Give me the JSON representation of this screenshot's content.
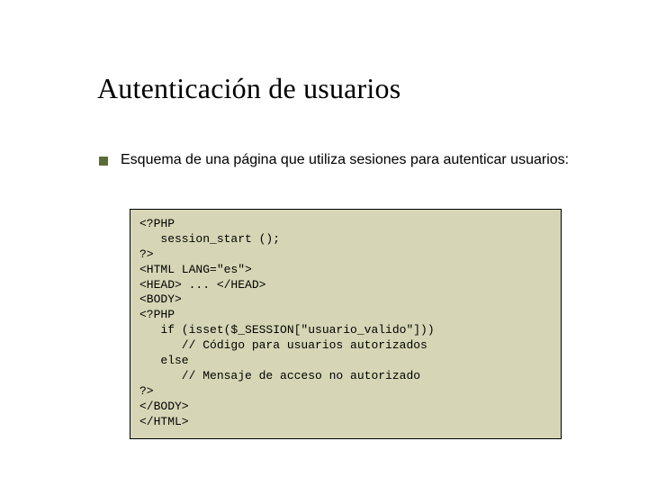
{
  "title": "Autenticación de usuarios",
  "bullet": {
    "text": "Esquema de una página que utiliza sesiones para autenticar usuarios:"
  },
  "code": "<?PHP\n   session_start ();\n?>\n<HTML LANG=\"es\">\n<HEAD> ... </HEAD>\n<BODY>\n<?PHP\n   if (isset($_SESSION[\"usuario_valido\"]))\n      // Código para usuarios autorizados\n   else\n      // Mensaje de acceso no autorizado\n?>\n</BODY>\n</HTML>",
  "colors": {
    "bullet_accent": "#5b6b37",
    "code_bg": "#d6d6b6"
  }
}
